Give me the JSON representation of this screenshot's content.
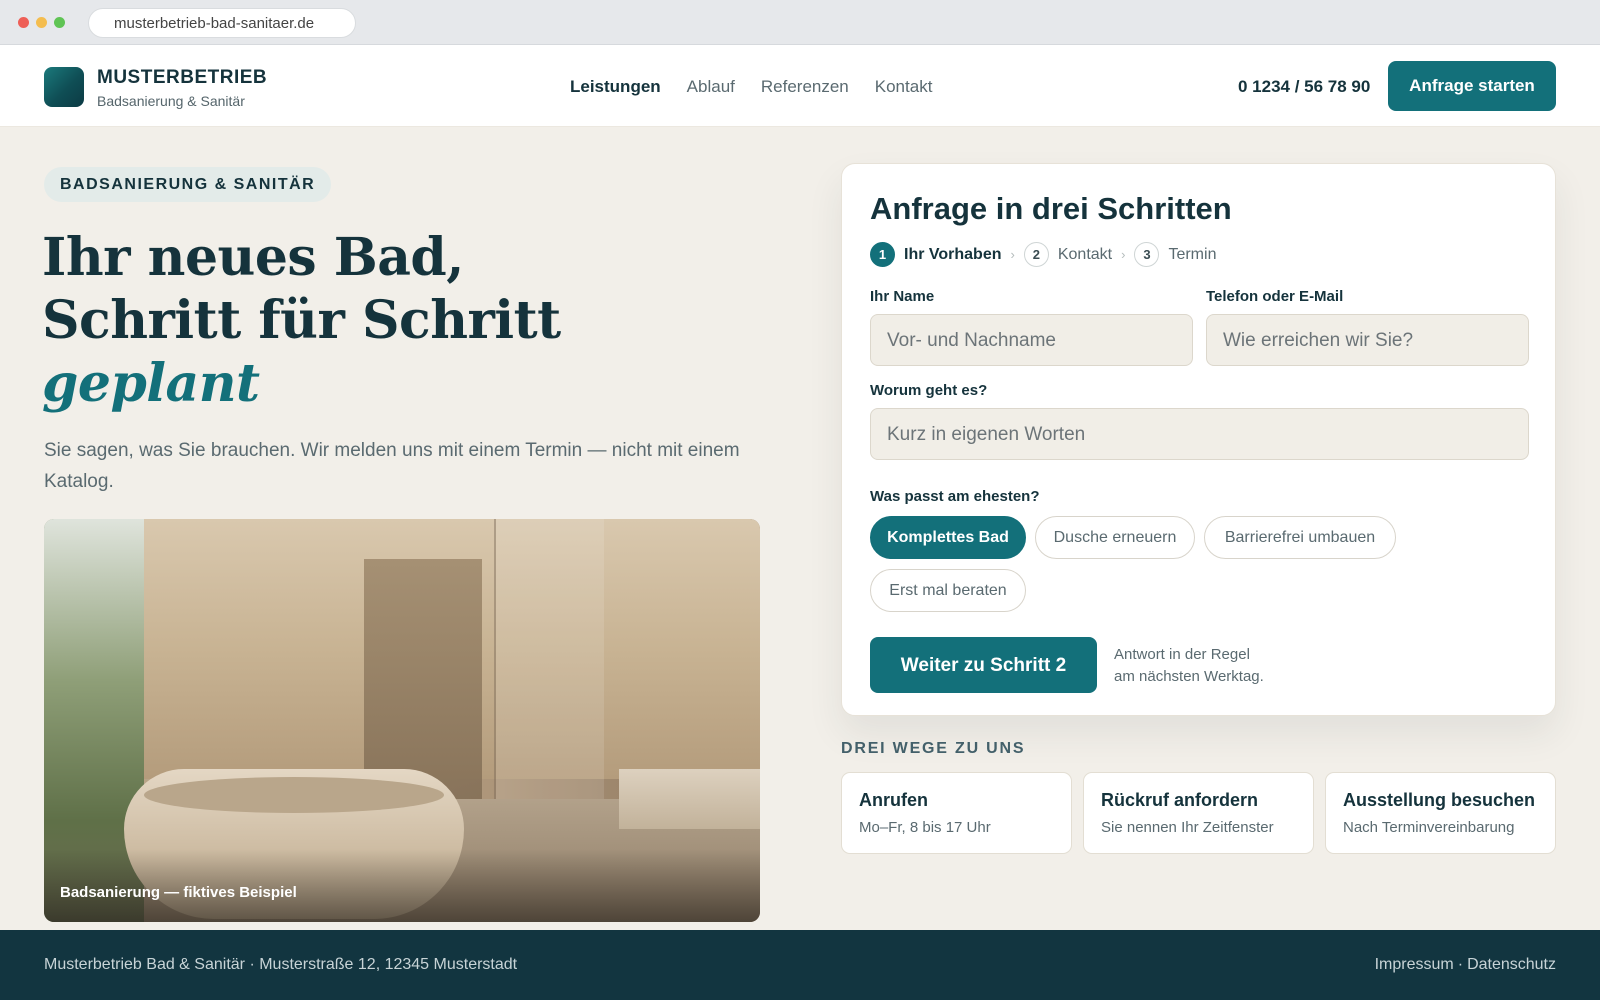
{
  "browser": {
    "url": "musterbetrieb-bad-sanitaer.de"
  },
  "header": {
    "brand_name": "MUSTERBETRIEB",
    "brand_sub": "Badsanierung & Sanitär",
    "nav": [
      "Leistungen",
      "Ablauf",
      "Referenzen",
      "Kontakt"
    ],
    "active_nav": "Leistungen",
    "phone": "0 1234 / 56 78 90",
    "cta": "Anfrage starten"
  },
  "hero": {
    "badge": "BADSANIERUNG & SANITÄR",
    "headline_line1": "Ihr neues Bad,",
    "headline_line2": "Schritt für Schritt",
    "headline_accent": "geplant",
    "lede": "Sie sagen, was Sie brauchen. Wir melden uns mit einem Termin — nicht mit einem Katalog.",
    "photo_caption": "Badsanierung — fiktives Beispiel"
  },
  "form": {
    "title": "Anfrage in drei Schritten",
    "steps": [
      {
        "num": "1",
        "label": "Ihr Vorhaben",
        "active": true
      },
      {
        "num": "2",
        "label": "Kontakt",
        "active": false
      },
      {
        "num": "3",
        "label": "Termin",
        "active": false
      }
    ],
    "name_label": "Ihr Name",
    "name_placeholder": "Vor- und Nachname",
    "contact_label": "Telefon oder E-Mail",
    "contact_placeholder": "Wie erreichen wir Sie?",
    "topic_label": "Worum geht es?",
    "topic_placeholder": "Kurz in eigenen Worten",
    "options_label": "Was passt am ehesten?",
    "options": [
      "Komplettes Bad",
      "Dusche erneuern",
      "Barrierefrei umbauen",
      "Erst mal beraten"
    ],
    "selected_option": "Komplettes Bad",
    "next_button": "Weiter zu Schritt 2",
    "note_line1": "Antwort in der Regel",
    "note_line2": "am nächsten Werktag."
  },
  "ways": {
    "title": "DREI WEGE ZU UNS",
    "items": [
      {
        "title": "Anrufen",
        "sub": "Mo–Fr, 8 bis 17 Uhr"
      },
      {
        "title": "Rückruf anfordern",
        "sub": "Sie nennen Ihr Zeitfenster"
      },
      {
        "title": "Ausstellung besuchen",
        "sub": "Nach Terminvereinbarung"
      }
    ]
  },
  "footer": {
    "address": "Musterbetrieb Bad & Sanitär · Musterstraße 12, 12345 Musterstadt",
    "impressum": "Impressum",
    "separator": "·",
    "datenschutz": "Datenschutz"
  },
  "colors": {
    "accent": "#13707a",
    "dark": "#15333c",
    "footer": "#123540",
    "page_bg": "#f2efe9"
  }
}
